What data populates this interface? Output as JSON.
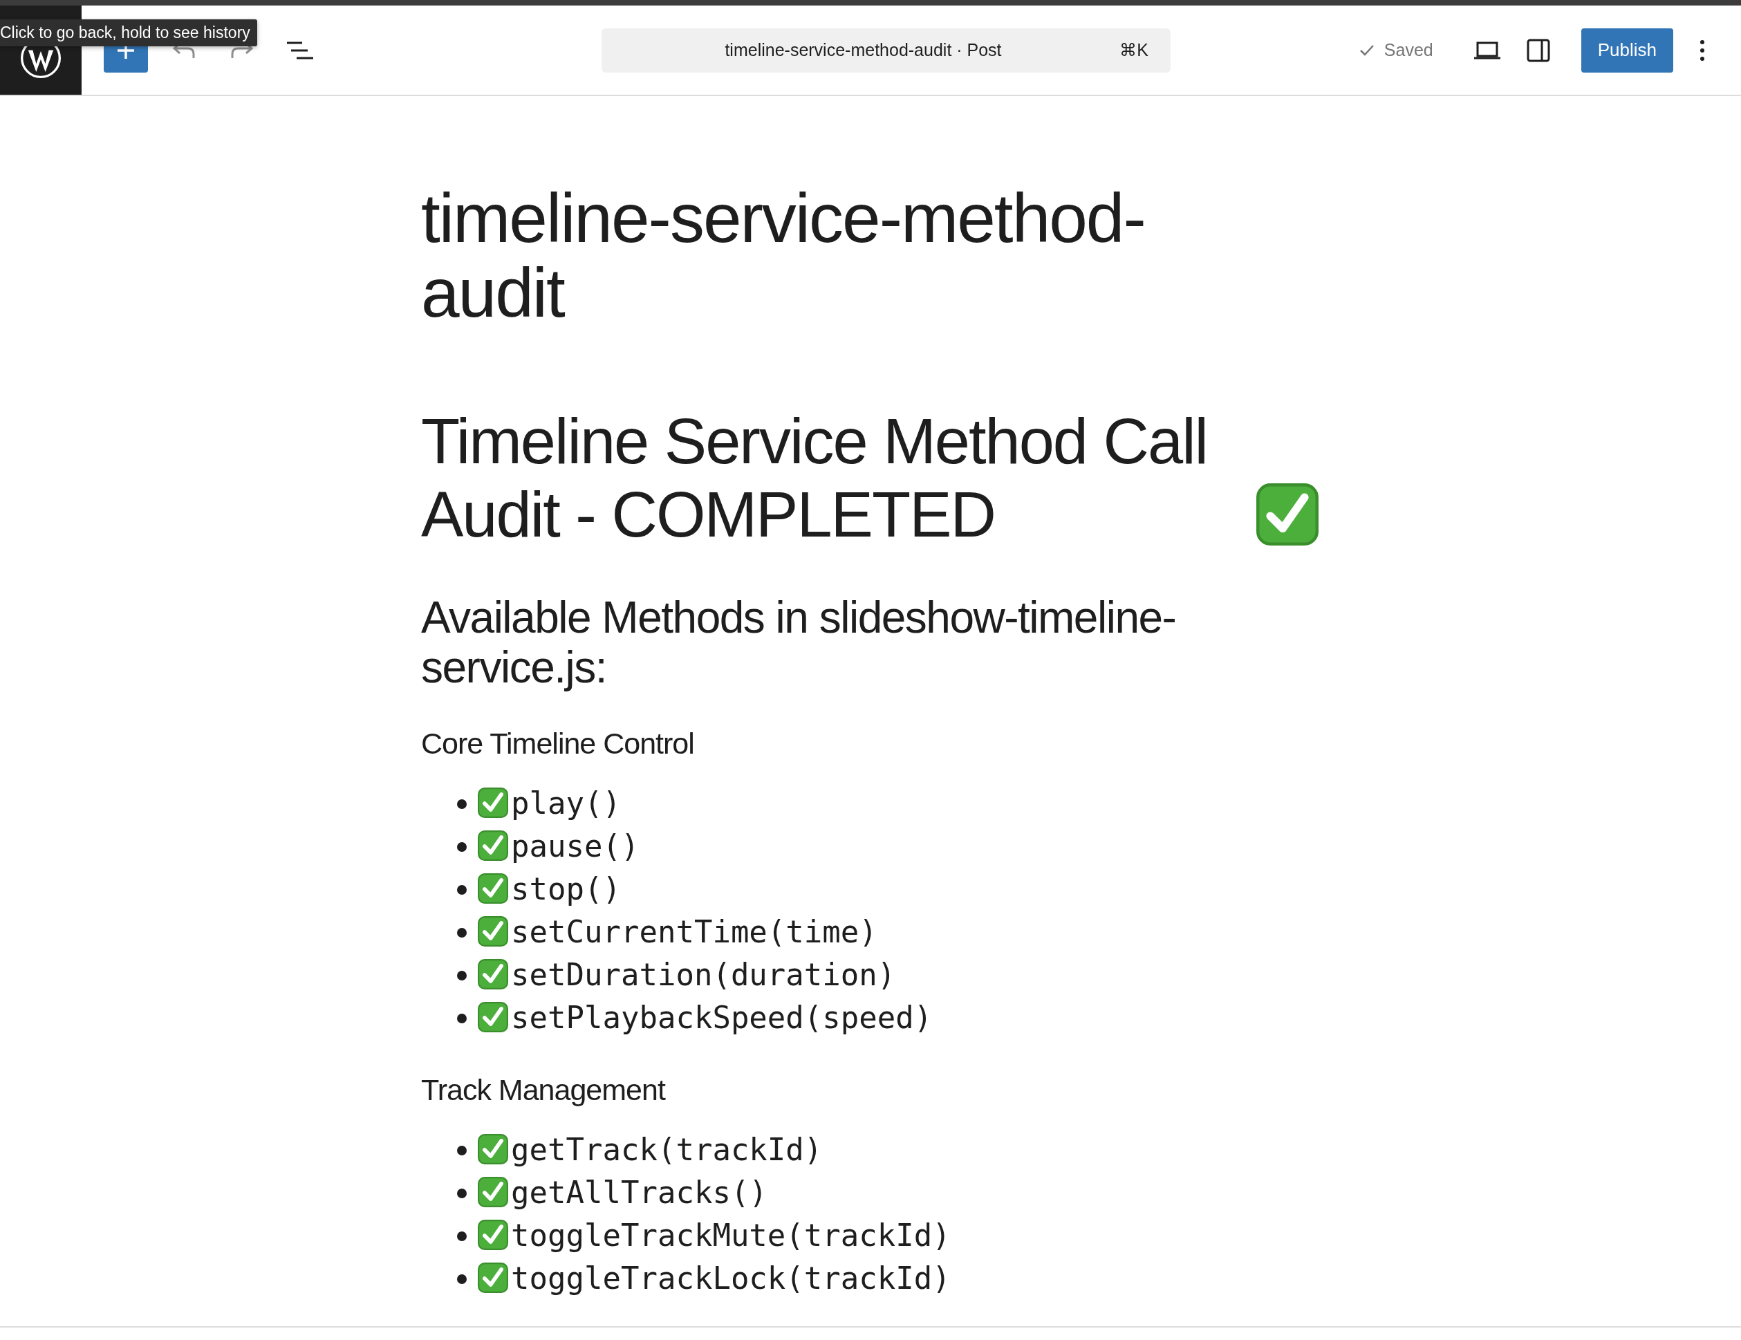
{
  "tooltip": "Click to go back, hold to see history",
  "command_bar": {
    "title": "timeline-service-method-audit · Post",
    "shortcut": "⌘K"
  },
  "status": "Saved",
  "publish": "Publish",
  "post_title": "timeline-service-method-audit",
  "heading": {
    "text": "Timeline Service Method Call Audit - COMPLETED",
    "done": true
  },
  "subheading": "Available Methods in slideshow-timeline-service.js:",
  "sections": [
    {
      "title": "Core Timeline Control",
      "items": [
        {
          "text": "play()",
          "done": true
        },
        {
          "text": "pause()",
          "done": true
        },
        {
          "text": "stop()",
          "done": true
        },
        {
          "text": "setCurrentTime(time)",
          "done": true
        },
        {
          "text": "setDuration(duration)",
          "done": true
        },
        {
          "text": "setPlaybackSpeed(speed)",
          "done": true
        }
      ]
    },
    {
      "title": "Track Management",
      "items": [
        {
          "text": "getTrack(trackId)",
          "done": true
        },
        {
          "text": "getAllTracks()",
          "done": true
        },
        {
          "text": "toggleTrackMute(trackId)",
          "done": true
        },
        {
          "text": "toggleTrackLock(trackId)",
          "done": true
        }
      ]
    }
  ]
}
